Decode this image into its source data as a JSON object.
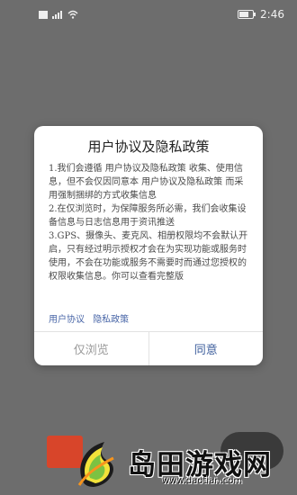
{
  "status": {
    "time": "2:46"
  },
  "dialog": {
    "title": "用户协议及隐私政策",
    "body": "1.我们会遵循 用户协议及隐私政策 收集、使用信息，但不会仅因同意本 用户协议及隐私政策 而采用强制捆绑的方式收集信息\n2.在仅浏览时，为保障服务所必需，我们会收集设备信息与日志信息用于资讯推送\n3.GPS、摄像头、麦克风、相册权限均不会默认开启，只有经过明示授权才会在为实现功能或服务时使用，不会在功能或服务不需要时而通过您授权的权限收集信息。你可以查看完整版",
    "link_user_agreement": "用户协议",
    "link_privacy": "隐私政策",
    "browse_only_button": "仅浏览",
    "agree_button": "同意"
  },
  "watermark": {
    "name": "岛田游戏网",
    "url": "www.daotian.com"
  }
}
